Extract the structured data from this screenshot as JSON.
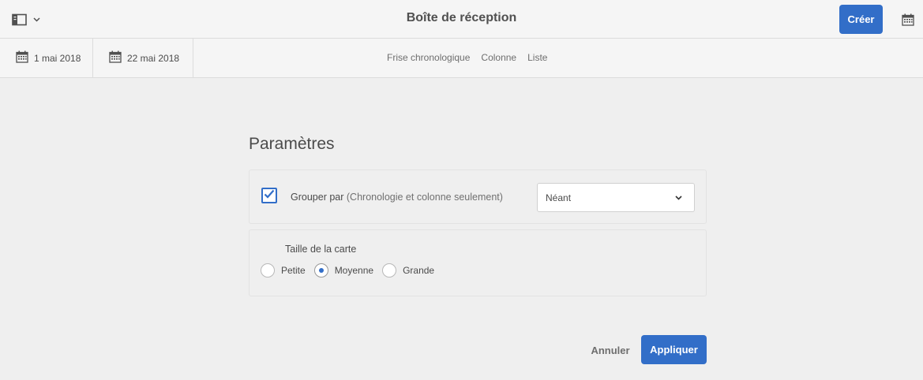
{
  "header": {
    "title": "Boîte de réception",
    "create_label": "Créer",
    "rail_icon": "panel-toggle-icon",
    "calendar_icon": "calendar-icon"
  },
  "toolbar": {
    "date_from": "1 mai 2018",
    "date_to": "22 mai 2018",
    "views": [
      "Frise chronologique",
      "Colonne",
      "Liste"
    ]
  },
  "settings": {
    "title": "Paramètres",
    "group_by": {
      "checked": true,
      "label": "Grouper par",
      "hint": "(Chronologie et colonne seulement)",
      "selected": "Néant"
    },
    "card_size": {
      "label": "Taille de la carte",
      "options": [
        "Petite",
        "Moyenne",
        "Grande"
      ],
      "selected": "Moyenne"
    }
  },
  "actions": {
    "cancel_label": "Annuler",
    "apply_label": "Appliquer"
  },
  "colors": {
    "accent": "#326ec8",
    "background": "#efefef"
  }
}
